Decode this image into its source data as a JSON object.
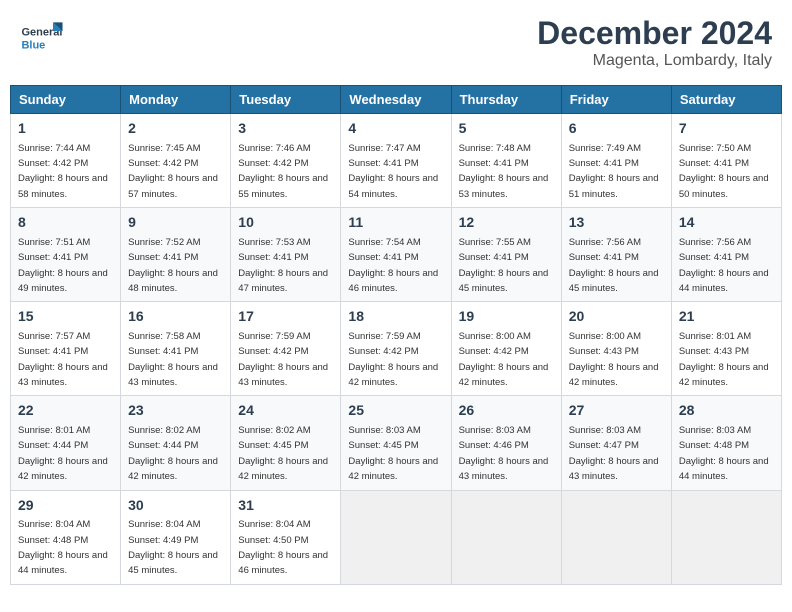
{
  "header": {
    "logo": {
      "text_general": "General",
      "text_blue": "Blue"
    },
    "month": "December 2024",
    "location": "Magenta, Lombardy, Italy"
  },
  "weekdays": [
    "Sunday",
    "Monday",
    "Tuesday",
    "Wednesday",
    "Thursday",
    "Friday",
    "Saturday"
  ],
  "weeks": [
    [
      {
        "day": "1",
        "sunrise": "7:44 AM",
        "sunset": "4:42 PM",
        "daylight": "8 hours and 58 minutes."
      },
      {
        "day": "2",
        "sunrise": "7:45 AM",
        "sunset": "4:42 PM",
        "daylight": "8 hours and 57 minutes."
      },
      {
        "day": "3",
        "sunrise": "7:46 AM",
        "sunset": "4:42 PM",
        "daylight": "8 hours and 55 minutes."
      },
      {
        "day": "4",
        "sunrise": "7:47 AM",
        "sunset": "4:41 PM",
        "daylight": "8 hours and 54 minutes."
      },
      {
        "day": "5",
        "sunrise": "7:48 AM",
        "sunset": "4:41 PM",
        "daylight": "8 hours and 53 minutes."
      },
      {
        "day": "6",
        "sunrise": "7:49 AM",
        "sunset": "4:41 PM",
        "daylight": "8 hours and 51 minutes."
      },
      {
        "day": "7",
        "sunrise": "7:50 AM",
        "sunset": "4:41 PM",
        "daylight": "8 hours and 50 minutes."
      }
    ],
    [
      {
        "day": "8",
        "sunrise": "7:51 AM",
        "sunset": "4:41 PM",
        "daylight": "8 hours and 49 minutes."
      },
      {
        "day": "9",
        "sunrise": "7:52 AM",
        "sunset": "4:41 PM",
        "daylight": "8 hours and 48 minutes."
      },
      {
        "day": "10",
        "sunrise": "7:53 AM",
        "sunset": "4:41 PM",
        "daylight": "8 hours and 47 minutes."
      },
      {
        "day": "11",
        "sunrise": "7:54 AM",
        "sunset": "4:41 PM",
        "daylight": "8 hours and 46 minutes."
      },
      {
        "day": "12",
        "sunrise": "7:55 AM",
        "sunset": "4:41 PM",
        "daylight": "8 hours and 45 minutes."
      },
      {
        "day": "13",
        "sunrise": "7:56 AM",
        "sunset": "4:41 PM",
        "daylight": "8 hours and 45 minutes."
      },
      {
        "day": "14",
        "sunrise": "7:56 AM",
        "sunset": "4:41 PM",
        "daylight": "8 hours and 44 minutes."
      }
    ],
    [
      {
        "day": "15",
        "sunrise": "7:57 AM",
        "sunset": "4:41 PM",
        "daylight": "8 hours and 43 minutes."
      },
      {
        "day": "16",
        "sunrise": "7:58 AM",
        "sunset": "4:41 PM",
        "daylight": "8 hours and 43 minutes."
      },
      {
        "day": "17",
        "sunrise": "7:59 AM",
        "sunset": "4:42 PM",
        "daylight": "8 hours and 43 minutes."
      },
      {
        "day": "18",
        "sunrise": "7:59 AM",
        "sunset": "4:42 PM",
        "daylight": "8 hours and 42 minutes."
      },
      {
        "day": "19",
        "sunrise": "8:00 AM",
        "sunset": "4:42 PM",
        "daylight": "8 hours and 42 minutes."
      },
      {
        "day": "20",
        "sunrise": "8:00 AM",
        "sunset": "4:43 PM",
        "daylight": "8 hours and 42 minutes."
      },
      {
        "day": "21",
        "sunrise": "8:01 AM",
        "sunset": "4:43 PM",
        "daylight": "8 hours and 42 minutes."
      }
    ],
    [
      {
        "day": "22",
        "sunrise": "8:01 AM",
        "sunset": "4:44 PM",
        "daylight": "8 hours and 42 minutes."
      },
      {
        "day": "23",
        "sunrise": "8:02 AM",
        "sunset": "4:44 PM",
        "daylight": "8 hours and 42 minutes."
      },
      {
        "day": "24",
        "sunrise": "8:02 AM",
        "sunset": "4:45 PM",
        "daylight": "8 hours and 42 minutes."
      },
      {
        "day": "25",
        "sunrise": "8:03 AM",
        "sunset": "4:45 PM",
        "daylight": "8 hours and 42 minutes."
      },
      {
        "day": "26",
        "sunrise": "8:03 AM",
        "sunset": "4:46 PM",
        "daylight": "8 hours and 43 minutes."
      },
      {
        "day": "27",
        "sunrise": "8:03 AM",
        "sunset": "4:47 PM",
        "daylight": "8 hours and 43 minutes."
      },
      {
        "day": "28",
        "sunrise": "8:03 AM",
        "sunset": "4:48 PM",
        "daylight": "8 hours and 44 minutes."
      }
    ],
    [
      {
        "day": "29",
        "sunrise": "8:04 AM",
        "sunset": "4:48 PM",
        "daylight": "8 hours and 44 minutes."
      },
      {
        "day": "30",
        "sunrise": "8:04 AM",
        "sunset": "4:49 PM",
        "daylight": "8 hours and 45 minutes."
      },
      {
        "day": "31",
        "sunrise": "8:04 AM",
        "sunset": "4:50 PM",
        "daylight": "8 hours and 46 minutes."
      },
      null,
      null,
      null,
      null
    ]
  ],
  "labels": {
    "sunrise": "Sunrise:",
    "sunset": "Sunset:",
    "daylight": "Daylight:"
  }
}
